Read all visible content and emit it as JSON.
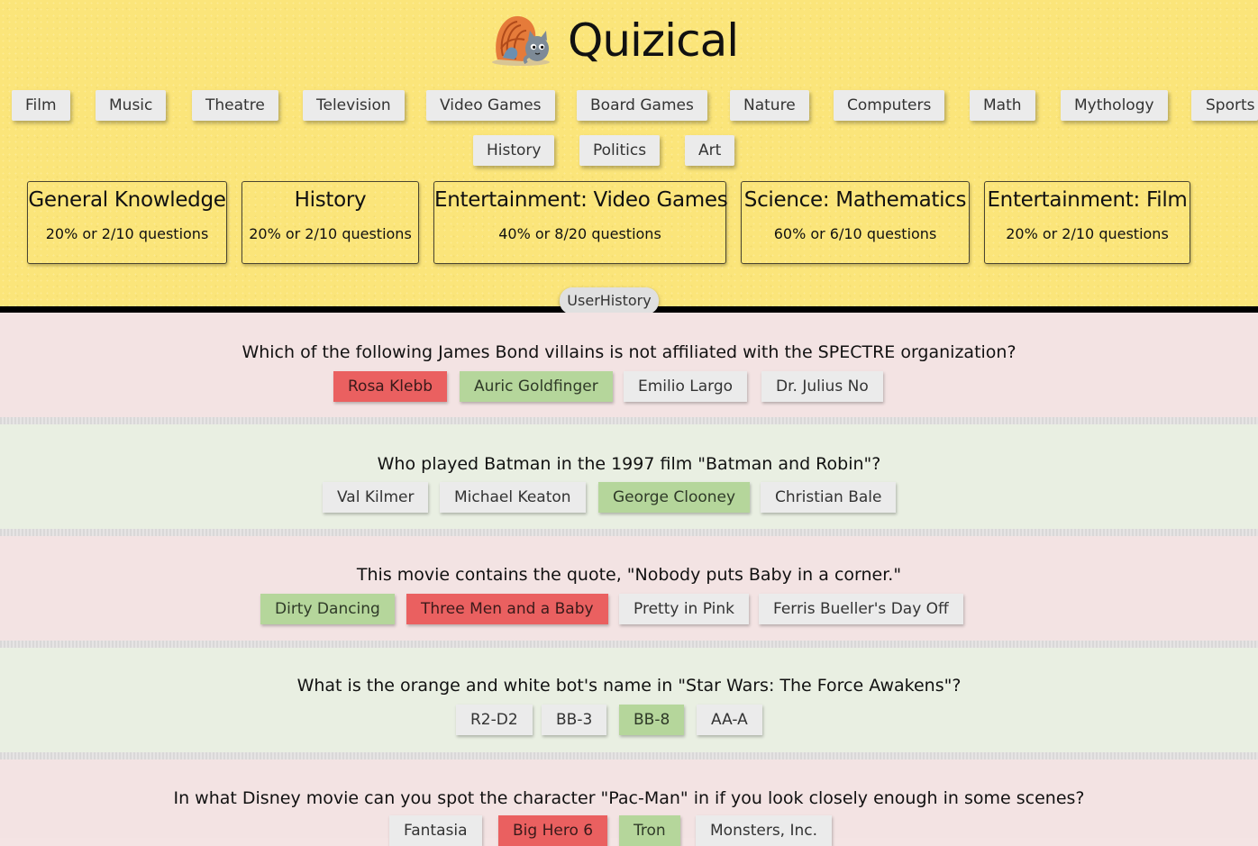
{
  "app": {
    "title": "Quizical"
  },
  "categories": [
    "Film",
    "Music",
    "Theatre",
    "Television",
    "Video Games",
    "Board Games",
    "Nature",
    "Computers",
    "Math",
    "Mythology",
    "Sports",
    "History",
    "Politics",
    "Art"
  ],
  "scores": [
    {
      "category": "General Knowledge",
      "summary": "20% or 2/10 questions"
    },
    {
      "category": "History",
      "summary": "20% or 2/10 questions"
    },
    {
      "category": "Entertainment: Video Games",
      "summary": "40% or 8/20 questions"
    },
    {
      "category": "Science: Mathematics",
      "summary": "60% or 6/10 questions"
    },
    {
      "category": "Entertainment: Film",
      "summary": "20% or 2/10 questions"
    }
  ],
  "user_history_label": "UserHistory",
  "colors": {
    "header_bg": "#fbe57a",
    "correct": "#b5d69b",
    "wrong": "#ea6060",
    "neutral": "#ebebeb"
  },
  "questions": [
    {
      "text": "Which of the following James Bond villains is not affiliated with the SPECTRE organization?",
      "answers": [
        {
          "label": "Rosa Klebb",
          "state": "wrong"
        },
        {
          "label": "Auric Goldfinger",
          "state": "correct"
        },
        {
          "label": "Emilio Largo",
          "state": "neutral"
        },
        {
          "label": "Dr. Julius No",
          "state": "neutral"
        }
      ]
    },
    {
      "text": "Who played Batman in the 1997 film \"Batman and Robin\"?",
      "answers": [
        {
          "label": "Val Kilmer",
          "state": "neutral"
        },
        {
          "label": "Michael Keaton",
          "state": "neutral"
        },
        {
          "label": "George Clooney",
          "state": "correct"
        },
        {
          "label": "Christian Bale",
          "state": "neutral"
        }
      ]
    },
    {
      "text": "This movie contains the quote, \"Nobody puts Baby in a corner.\"",
      "answers": [
        {
          "label": "Dirty Dancing",
          "state": "correct"
        },
        {
          "label": "Three Men and a Baby",
          "state": "wrong"
        },
        {
          "label": "Pretty in Pink",
          "state": "neutral"
        },
        {
          "label": "Ferris Bueller's Day Off",
          "state": "neutral"
        }
      ]
    },
    {
      "text": "What is the orange and white bot's name in \"Star Wars: The Force Awakens\"?",
      "answers": [
        {
          "label": "R2-D2",
          "state": "neutral"
        },
        {
          "label": "BB-3",
          "state": "neutral"
        },
        {
          "label": "BB-8",
          "state": "correct"
        },
        {
          "label": "AA-A",
          "state": "neutral"
        }
      ]
    },
    {
      "text": "In what Disney movie can you spot the character \"Pac-Man\" in if you look closely enough in some scenes?",
      "answers": [
        {
          "label": "Fantasia",
          "state": "neutral"
        },
        {
          "label": "Big Hero 6",
          "state": "wrong"
        },
        {
          "label": "Tron",
          "state": "correct"
        },
        {
          "label": "Monsters, Inc.",
          "state": "neutral"
        }
      ]
    }
  ]
}
